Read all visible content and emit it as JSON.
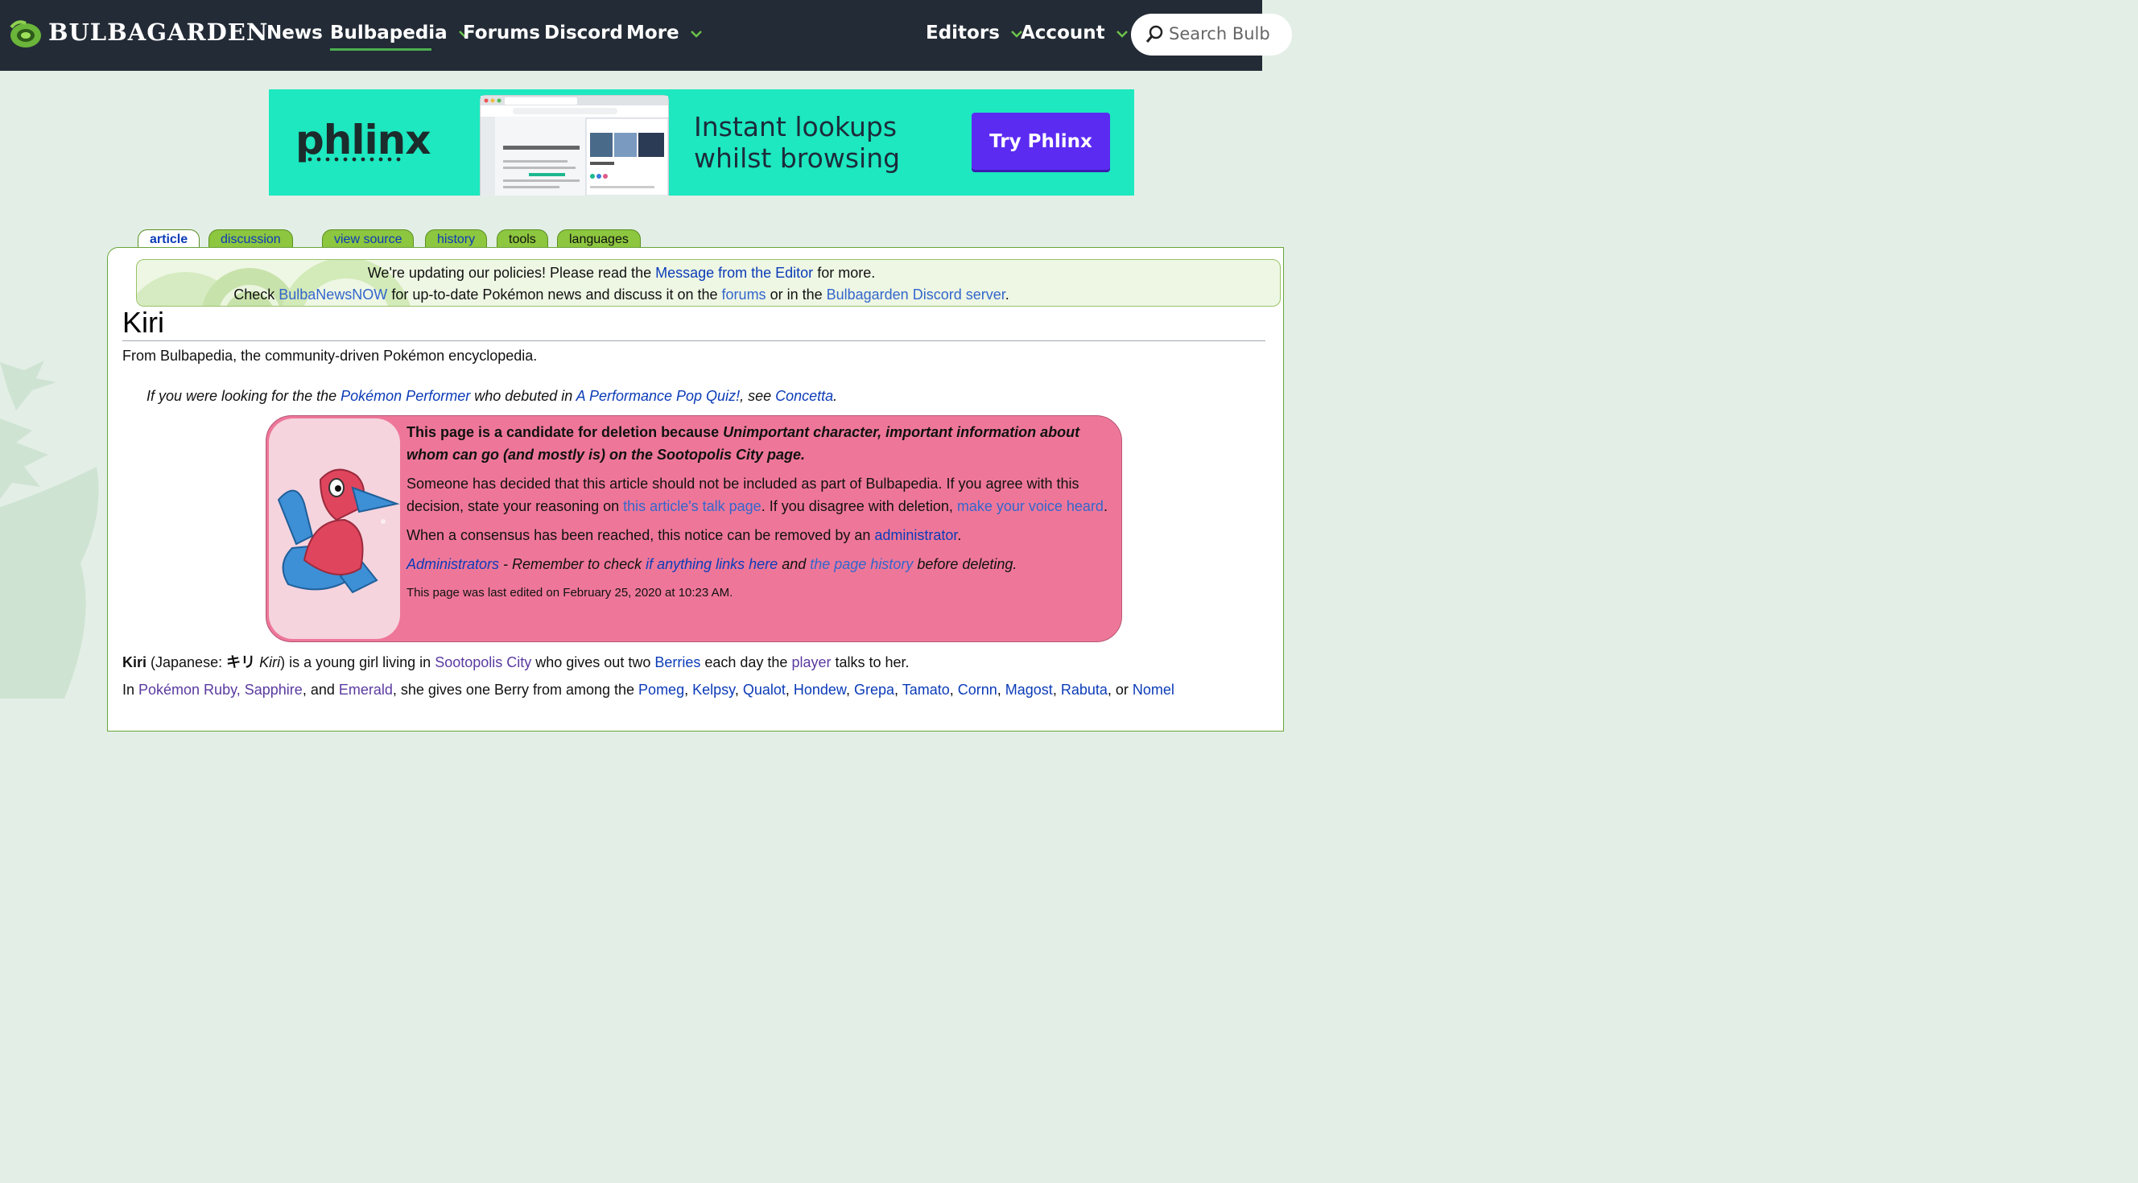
{
  "nav": {
    "logo": "BULBAGARDEN",
    "items": [
      "News",
      "Bulbapedia",
      "Forums",
      "Discord",
      "More"
    ],
    "right_items": [
      "Editors",
      "Account"
    ],
    "search_placeholder": "Search Bulb"
  },
  "ad": {
    "brand": "phlinx",
    "tagline_1": "Instant lookups",
    "tagline_2": "whilst browsing",
    "cta": "Try Phlinx"
  },
  "tabs": [
    "article",
    "discussion",
    "view source",
    "history",
    "tools",
    "languages"
  ],
  "sitenotice": {
    "l1_a": "We're updating our policies! Please read the ",
    "l1_link": "Message from the Editor",
    "l1_b": " for more.",
    "l2_a": "Check ",
    "l2_link1": "BulbaNewsNOW",
    "l2_b": " for up-to-date Pokémon news and discuss it on the ",
    "l2_link2": "forums",
    "l2_c": " or in the ",
    "l2_link3": "Bulbagarden Discord server",
    "l2_d": "."
  },
  "page": {
    "title": "Kiri",
    "tagline": "From Bulbapedia, the community-driven Pokémon encyclopedia."
  },
  "hatnote": {
    "a": "If you were looking for the the ",
    "link1": "Pokémon Performer",
    "b": " who debuted in ",
    "link2": "A Performance Pop Quiz!",
    "c": ", see ",
    "link3": "Concetta",
    "d": "."
  },
  "deletion": {
    "bold_a": "This page is a candidate for deletion because ",
    "bold_reason": "Unimportant character, important information about whom can go (and mostly is) on the Sootopolis City page.",
    "p2_a": "Someone has decided that this article should not be included as part of Bulbapedia. If you agree with this decision, state your reasoning on ",
    "p2_link1": "this article's talk page",
    "p2_b": ". If you disagree with deletion, ",
    "p2_link2": "make your voice heard",
    "p2_c": ".",
    "p3_a": "When a consensus has been reached, this notice can be removed by an ",
    "p3_link": "administrator",
    "p3_b": ".",
    "p4_link1": "Administrators",
    "p4_a": " - Remember to check ",
    "p4_link2": "if anything links here",
    "p4_b": " and ",
    "p4_link3": "the page history",
    "p4_c": " before deleting.",
    "edited": "This page was last edited on February 25, 2020 at 10:23 AM."
  },
  "para1": {
    "bold": "Kiri",
    "a": " (Japanese: ",
    "jp": "キリ",
    "romaji": "Kiri",
    "b": ") is a young girl living in ",
    "link1": "Sootopolis City",
    "c": " who gives out two ",
    "link2": "Berries",
    "d": " each day the ",
    "link3": "player",
    "e": " talks to her."
  },
  "para2": {
    "a": "In ",
    "link1": "Pokémon Ruby, Sapphire",
    "b": ", and ",
    "link2": "Emerald",
    "c": ", she gives one Berry from among the ",
    "berries": [
      "Pomeg",
      "Kelpsy",
      "Qualot",
      "Hondew",
      "Grepa",
      "Tamato",
      "Cornn",
      "Magost",
      "Rabuta"
    ],
    "sep": ", ",
    "d": ", or ",
    "link_last": "Nomel"
  }
}
